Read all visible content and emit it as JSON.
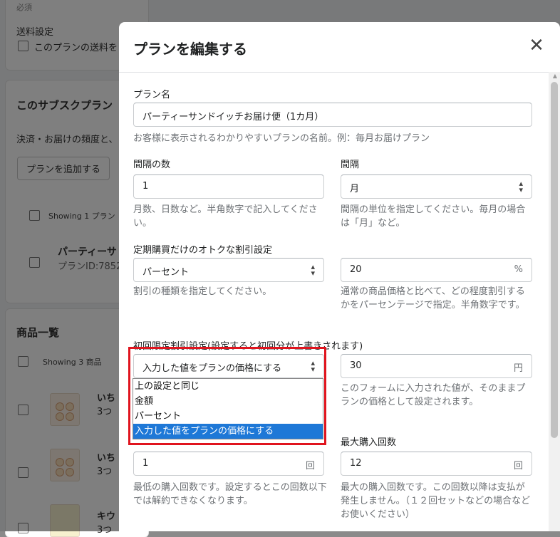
{
  "background": {
    "required": "必須",
    "shipping_label": "送料設定",
    "shipping_checkbox": "このプランの送料を",
    "subscription_title": "このサブスクプラン",
    "subscription_desc": "決済・お届けの頻度と、",
    "add_plan_button": "プランを追加する",
    "showing_plans": "Showing 1 プラン",
    "plan_row_title": "パーティーサ",
    "plan_row_id": "プランID:7852",
    "products_title": "商品一覧",
    "showing_products": "Showing 3 商品",
    "products": [
      {
        "name": "いち",
        "qty": "3つ"
      },
      {
        "name": "いち",
        "qty": "3つ"
      },
      {
        "name": "キウ",
        "qty": "3つ"
      }
    ]
  },
  "modal": {
    "title": "プランを編集する",
    "close_icon": "close-icon",
    "plan_name": {
      "label": "プラン名",
      "value": "パーティーサンドイッチお届け便（1カ月）",
      "help": "お客様に表示されるわかりやすいプランの名前。例：毎月お届けプラン"
    },
    "interval_count": {
      "label": "間隔の数",
      "value": "1",
      "help": "月数、日数など。半角数字で記入してください。"
    },
    "interval": {
      "label": "間隔",
      "value": "月",
      "help": "間隔の単位を指定してください。毎月の場合は「月」など。"
    },
    "discount": {
      "label": "定期購買だけのオトクな割引設定",
      "type_value": "パーセント",
      "type_help": "割引の種類を指定してください。",
      "amount_value": "20",
      "amount_suffix": "%",
      "amount_help": "通常の商品価格と比べて、どの程度割引するかをパーセンテージで指定。半角数字です。"
    },
    "first_discount": {
      "label": "初回限定割引設定(設定すると初回分が上書きされます)",
      "type_value": "入力した値をプランの価格にする",
      "amount_value": "30",
      "amount_suffix": "円",
      "amount_help": "このフォームに入力された値が、そのままプランの価格として設定されます。",
      "options": [
        "上の設定と同じ",
        "金額",
        "パーセント",
        "入力した値をプランの価格にする"
      ],
      "selected_index": 3
    },
    "min_purchases": {
      "value": "1",
      "suffix": "回",
      "help": "最低の購入回数です。設定するとこの回数以下では解約できなくなります。"
    },
    "max_purchases": {
      "label": "最大購入回数",
      "value": "12",
      "suffix": "回",
      "help": "最大の購入回数です。この回数以降は支払が発生しません。（１２回セットなどの場合などお使いください）"
    }
  }
}
